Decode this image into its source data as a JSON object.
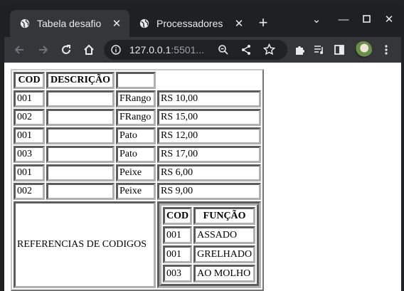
{
  "tabs": [
    {
      "label": "Tabela desafio",
      "active": true
    },
    {
      "label": "Processadores",
      "active": false
    }
  ],
  "toolbar": {
    "url_host": "127.0.0.1",
    "url_rest": ":5501..."
  },
  "table": {
    "headers": {
      "cod": "COD",
      "descricao": "DESCRIÇÃO",
      "blank": ""
    },
    "rows": [
      {
        "cod": "001",
        "desc": "",
        "meat": "FRango",
        "price": "RS 10,00"
      },
      {
        "cod": "002",
        "desc": "",
        "meat": "FRango",
        "price": "RS 15,00"
      },
      {
        "cod": "001",
        "desc": "",
        "meat": "Pato",
        "price": "RS 12,00"
      },
      {
        "cod": "003",
        "desc": "",
        "meat": "Pato",
        "price": "RS 17,00"
      },
      {
        "cod": "001",
        "desc": "",
        "meat": "Peixe",
        "price": "RS 6,00"
      },
      {
        "cod": "002",
        "desc": "",
        "meat": "Peixe",
        "price": "RS 9,00"
      }
    ],
    "reference_label": "REFERENCIAS DE CODIGOS",
    "inner": {
      "headers": {
        "cod": "COD",
        "funcao": "FUNÇÃO"
      },
      "rows": [
        {
          "cod": "001",
          "funcao": "ASSADO"
        },
        {
          "cod": "001",
          "funcao": "GRELHADO"
        },
        {
          "cod": "003",
          "funcao": "AO MOLHO"
        }
      ]
    }
  },
  "colors": {
    "tab_active": "#35363a",
    "frame": "#1f2023",
    "content_bg": "#ffffff"
  }
}
